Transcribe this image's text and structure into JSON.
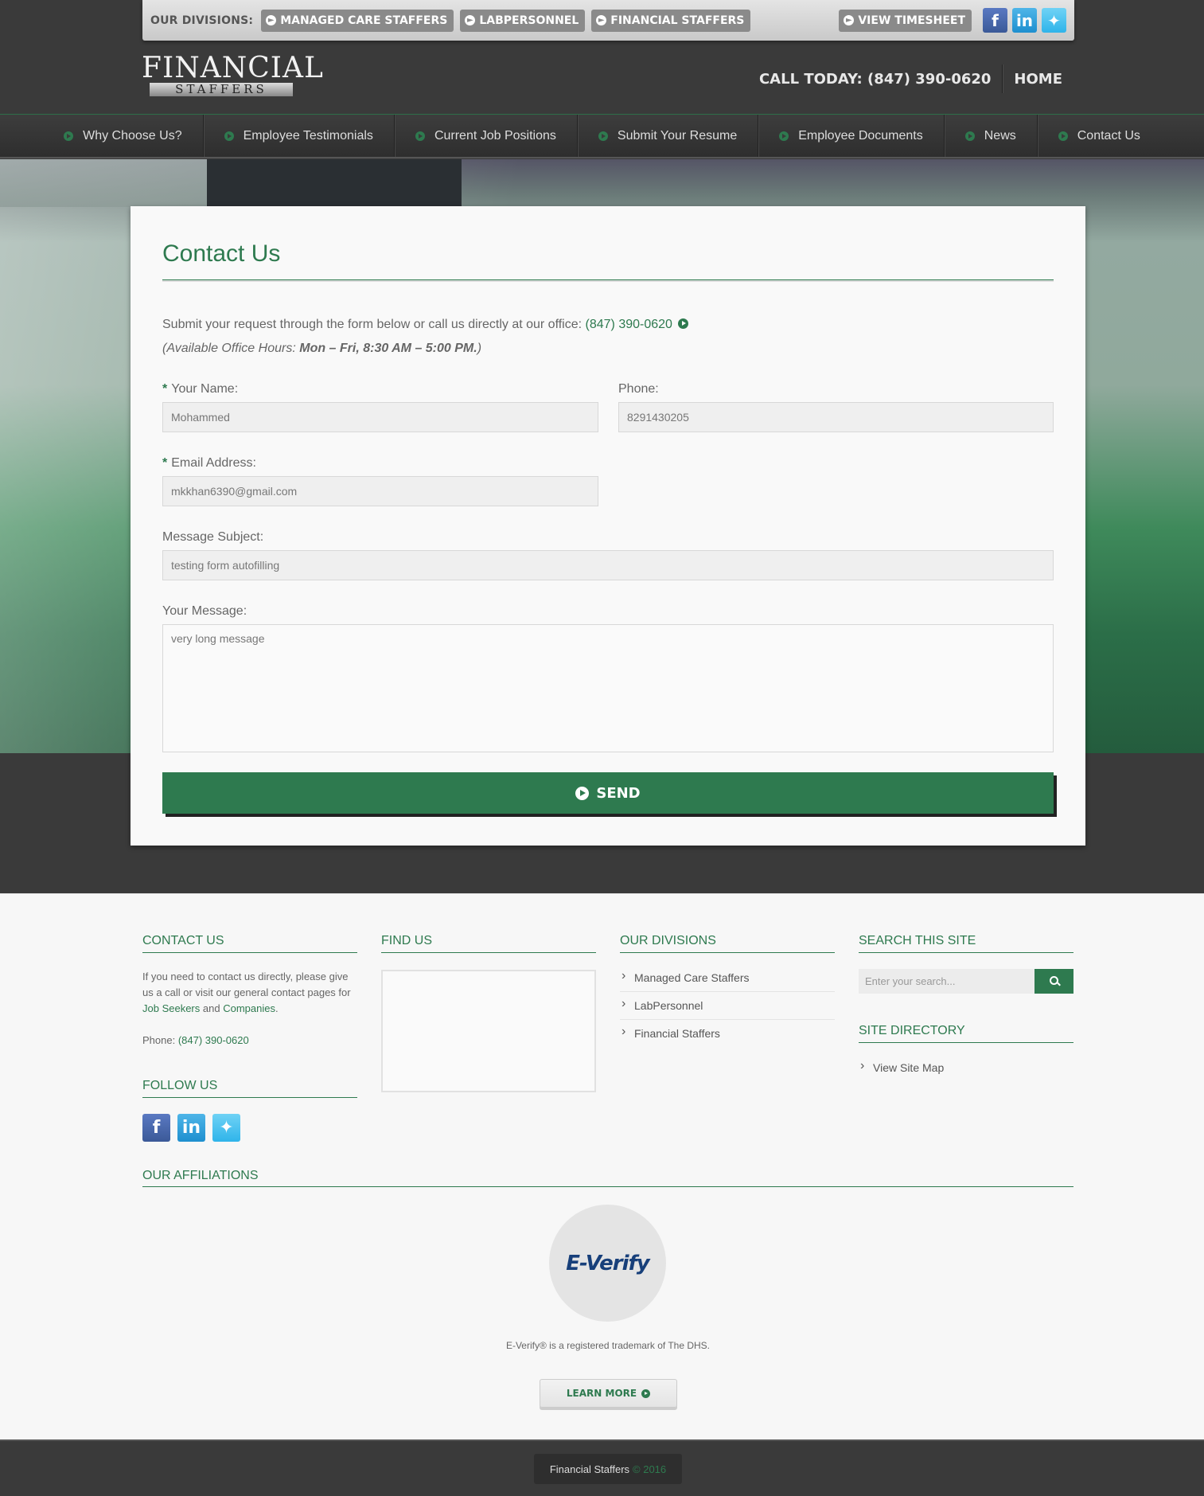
{
  "topbar": {
    "divisions_label": "OUR DIVISIONS:",
    "divisions": [
      "MANAGED CARE STAFFERS",
      "LABPERSONNEL",
      "FINANCIAL STAFFERS"
    ],
    "timesheet_label": "VIEW TIMESHEET",
    "social_icons": [
      "facebook-icon",
      "linkedin-icon",
      "twitter-icon"
    ]
  },
  "header": {
    "logo_main": "FINANCIAL",
    "logo_sub": "STAFFERS",
    "call_label": "CALL TODAY: (847) 390-0620",
    "home_label": "HOME"
  },
  "nav": {
    "items": [
      "Why Choose Us?",
      "Employee Testimonials",
      "Current Job Positions",
      "Submit Your Resume",
      "Employee Documents",
      "News",
      "Contact Us"
    ]
  },
  "form": {
    "title": "Contact Us",
    "intro_text": "Submit your request through the form below or call us directly at our office:",
    "intro_phone": "(847) 390-0620",
    "hours_prefix": "(Available Office Hours:",
    "hours_value": "Mon – Fri, 8:30 AM – 5:00 PM.",
    "hours_suffix": ")",
    "required_mark": "*",
    "name_label": "Your Name:",
    "name_value": "Mohammed",
    "phone_label": "Phone:",
    "phone_value": "8291430205",
    "email_label": "Email Address:",
    "email_value": "mkkhan6390@gmail.com",
    "subject_label": "Message Subject:",
    "subject_value": "testing form autofilling",
    "message_label": "Your Message:",
    "message_value": "very long message",
    "send_label": "SEND"
  },
  "footer": {
    "contact_heading": "CONTACT US",
    "contact_text": "If you need to contact us directly, please give us a call or visit our general contact pages for",
    "job_seekers_link": "Job Seekers",
    "and_word": "and",
    "companies_link": "Companies",
    "period": ".",
    "phone_label": "Phone:",
    "phone_value": "(847) 390-0620",
    "follow_heading": "FOLLOW US",
    "find_heading": "FIND US",
    "divisions_heading": "OUR DIVISIONS",
    "divisions": [
      "Managed Care Staffers",
      "LabPersonnel",
      "Financial Staffers"
    ],
    "search_heading": "SEARCH THIS SITE",
    "search_placeholder": "Enter your search...",
    "directory_heading": "SITE DIRECTORY",
    "directory_item": "View Site Map",
    "affiliations_heading": "OUR AFFILIATIONS",
    "everify_logo": "E-Verify",
    "everify_note": "E-Verify® is a registered trademark of The DHS.",
    "learn_more_label": "LEARN MORE",
    "copyright_name": "Financial Staffers",
    "copyright_year": "© 2016"
  },
  "colors": {
    "accent": "#2e7a4f",
    "dark_bg": "#3a3a3a",
    "footer_bg": "#f7f7f7"
  }
}
